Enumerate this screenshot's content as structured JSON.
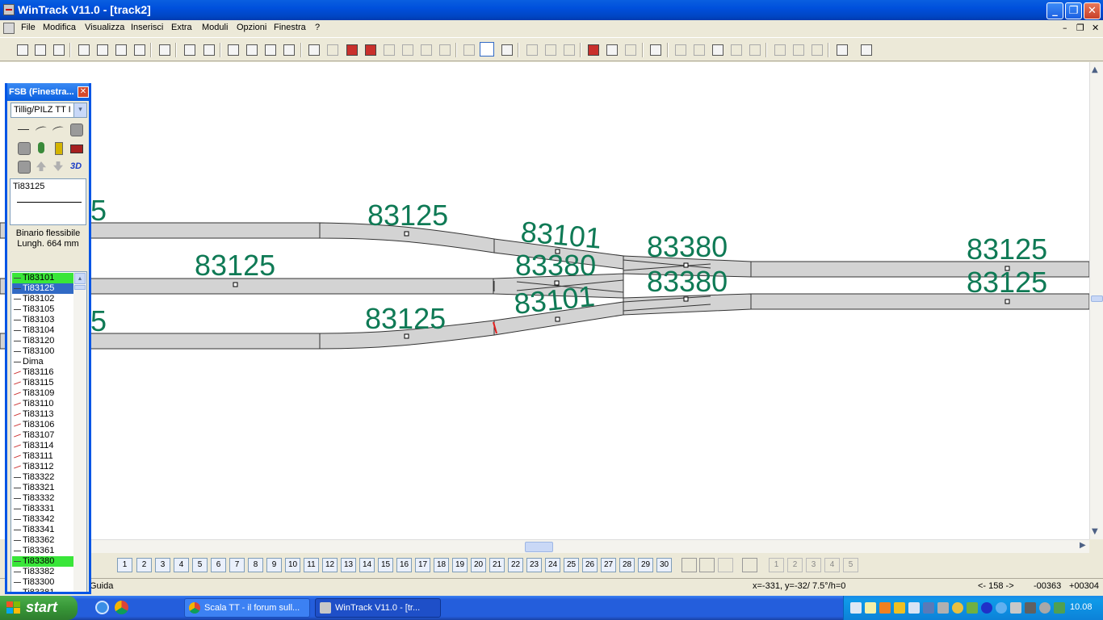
{
  "window": {
    "title": "WinTrack  V11.0 - [track2]",
    "min_glyph": "_",
    "max_glyph": "❐",
    "close_glyph": "✕"
  },
  "menu": {
    "items": [
      "File",
      "Modifica",
      "Visualizza",
      "Inserisci",
      "Extra",
      "Moduli",
      "Opzioni",
      "Finestra",
      "?"
    ],
    "mdi_min": "–",
    "mdi_restore": "❐",
    "mdi_close": "✕"
  },
  "fsb": {
    "title": "FSB (Finestra...",
    "close_glyph": "✕",
    "library": "Tillig/PILZ  TT I",
    "dropdown_glyph": "▾",
    "threed_label": "3D",
    "preview_label": "Ti83125",
    "desc_line1": "Binario flessibile",
    "desc_line2": "Lungh. 664 mm",
    "list_up": "▴",
    "list": [
      {
        "label": "Ti83101",
        "state": "hl",
        "kind": "straight"
      },
      {
        "label": "Ti83125",
        "state": "sel",
        "kind": "straight"
      },
      {
        "label": "Ti83102",
        "state": "",
        "kind": "straight"
      },
      {
        "label": "Ti83105",
        "state": "",
        "kind": "straight"
      },
      {
        "label": "Ti83103",
        "state": "",
        "kind": "straight"
      },
      {
        "label": "Ti83104",
        "state": "",
        "kind": "straight"
      },
      {
        "label": "Ti83120",
        "state": "",
        "kind": "straight"
      },
      {
        "label": "Ti83100",
        "state": "",
        "kind": "straight"
      },
      {
        "label": "Dima",
        "state": "",
        "kind": "straight"
      },
      {
        "label": "Ti83116",
        "state": "",
        "kind": "curve"
      },
      {
        "label": "Ti83115",
        "state": "",
        "kind": "curve"
      },
      {
        "label": "Ti83109",
        "state": "",
        "kind": "curve"
      },
      {
        "label": "Ti83110",
        "state": "",
        "kind": "curve"
      },
      {
        "label": "Ti83113",
        "state": "",
        "kind": "curve"
      },
      {
        "label": "Ti83106",
        "state": "",
        "kind": "curve"
      },
      {
        "label": "Ti83107",
        "state": "",
        "kind": "curve"
      },
      {
        "label": "Ti83114",
        "state": "",
        "kind": "curve"
      },
      {
        "label": "Ti83111",
        "state": "",
        "kind": "curve"
      },
      {
        "label": "Ti83112",
        "state": "",
        "kind": "curve"
      },
      {
        "label": "Ti83322",
        "state": "",
        "kind": "straight"
      },
      {
        "label": "Ti83321",
        "state": "",
        "kind": "straight"
      },
      {
        "label": "Ti83332",
        "state": "",
        "kind": "straight"
      },
      {
        "label": "Ti83331",
        "state": "",
        "kind": "straight"
      },
      {
        "label": "Ti83342",
        "state": "",
        "kind": "straight"
      },
      {
        "label": "Ti83341",
        "state": "",
        "kind": "straight"
      },
      {
        "label": "Ti83362",
        "state": "",
        "kind": "straight"
      },
      {
        "label": "Ti83361",
        "state": "",
        "kind": "straight"
      },
      {
        "label": "Ti83380",
        "state": "hl",
        "kind": "straight"
      },
      {
        "label": "Ti83382",
        "state": "",
        "kind": "straight"
      },
      {
        "label": "Ti83300",
        "state": "",
        "kind": "straight"
      },
      {
        "label": "Ti83381",
        "state": "",
        "kind": "straight"
      }
    ]
  },
  "canvas": {
    "labels": {
      "t1": "83125",
      "t2": "83101",
      "t3": "83380",
      "t4": "83125",
      "m1": "83125",
      "m2": "83380",
      "m3": "83380",
      "m4": "83125",
      "b1": "83125",
      "b2": "83101",
      "lt": "5",
      "lb": "5"
    }
  },
  "scroll": {
    "up": "▲",
    "down": "▼",
    "left": "◀",
    "right": "▶",
    "grip": "|||"
  },
  "layers": {
    "first": "1",
    "numbers": [
      "2",
      "3",
      "4",
      "5",
      "6",
      "7",
      "8",
      "9",
      "10",
      "11",
      "12",
      "13",
      "14",
      "15",
      "16",
      "17",
      "18",
      "19",
      "20",
      "21",
      "22",
      "23",
      "24",
      "25",
      "26",
      "27",
      "28",
      "29",
      "30"
    ],
    "disabled": [
      "1",
      "2",
      "3",
      "4",
      "5"
    ]
  },
  "status": {
    "left": "Guida",
    "coords": "x=-331, y=-32/ 7.5°/h=0",
    "range": "<- 158 ->",
    "x": "-00363",
    "y": "+00304"
  },
  "taskbar": {
    "start": "start",
    "tasks": [
      {
        "label": "Scala TT - il forum sull..."
      },
      {
        "label": "WinTrack  V11.0 - [tr..."
      }
    ],
    "clock": "10.08"
  },
  "colors": {
    "track_fill": "#d3d3d3",
    "track_stroke": "#333333",
    "label": "#0f7a55",
    "highlight": "#39e639",
    "selection": "#316ac5",
    "titlebar": "#0055e5"
  }
}
